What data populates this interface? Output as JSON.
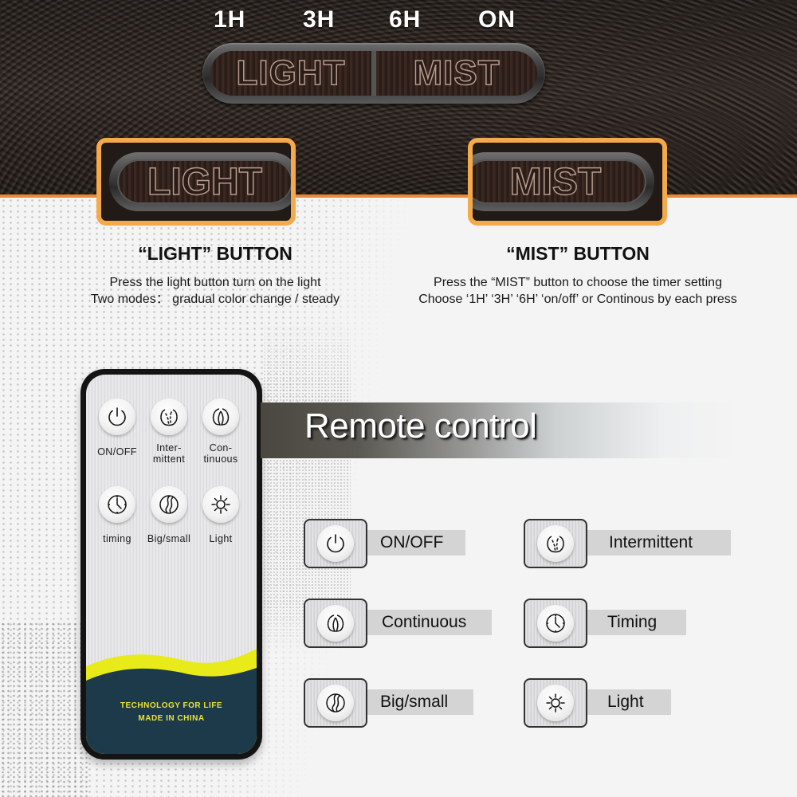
{
  "device_panel": {
    "timer_labels": [
      "1H",
      "3H",
      "6H",
      "ON"
    ],
    "keys": [
      "LIGHT",
      "MIST"
    ]
  },
  "highlights": {
    "light_key": "LIGHT",
    "mist_key": "MIST",
    "accent_color": "#f4a94a"
  },
  "light_button": {
    "title": "“LIGHT” BUTTON",
    "lines": [
      "Press the light button turn on the light",
      "Two modes： gradual color change / steady"
    ]
  },
  "mist_button": {
    "title": "“MIST” BUTTON",
    "lines": [
      "Press the “MIST” button to choose the timer setting",
      "Choose ‘1H’ ‘3H’ ‘6H’ ‘on/off’ or Continous by each press"
    ]
  },
  "remote": {
    "buttons": [
      {
        "icon": "power-icon",
        "label_lines": [
          "ON/OFF"
        ]
      },
      {
        "icon": "intermittent-mist-icon",
        "label_lines": [
          "Inter-",
          "mittent"
        ]
      },
      {
        "icon": "continuous-mist-icon",
        "label_lines": [
          "Con-",
          "tinuous"
        ]
      },
      {
        "icon": "clock-icon",
        "label_lines": [
          "timing"
        ]
      },
      {
        "icon": "big-small-mist-icon",
        "label_lines": [
          "Big/small"
        ]
      },
      {
        "icon": "sun-icon",
        "label_lines": [
          "Light"
        ]
      }
    ],
    "brand_lines": [
      "TECHNOLOGY FOR LIFE",
      "MADE IN CHINA"
    ],
    "colors": {
      "wave_yellow": "#e8ea1a",
      "bottom_navy": "#1d3a4a",
      "brand_text": "#e9e33a"
    }
  },
  "banner": {
    "title": "Remote control"
  },
  "legend": [
    {
      "icon": "power-icon",
      "label": "ON/OFF"
    },
    {
      "icon": "intermittent-mist-icon",
      "label": "Intermittent"
    },
    {
      "icon": "continuous-mist-icon",
      "label": "Continuous"
    },
    {
      "icon": "clock-icon",
      "label": "Timing"
    },
    {
      "icon": "big-small-mist-icon",
      "label": "Big/small"
    },
    {
      "icon": "sun-icon",
      "label": "Light"
    }
  ]
}
